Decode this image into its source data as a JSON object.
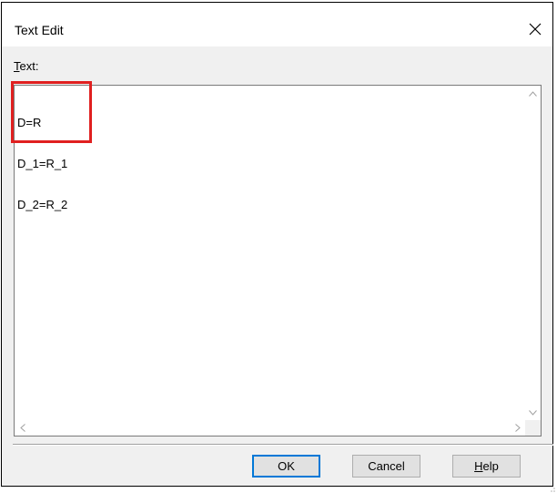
{
  "dialog": {
    "title": "Text Edit",
    "label_mnemonic": "T",
    "label_rest": "ext:",
    "lines": [
      "D=R",
      "D_1=R_1",
      "D_2=R_2"
    ],
    "buttons": {
      "ok": "OK",
      "cancel": "Cancel",
      "help_mnemonic": "H",
      "help_rest": "elp"
    }
  },
  "colors": {
    "highlight": "#e02020",
    "default_button_border": "#0078d7"
  }
}
